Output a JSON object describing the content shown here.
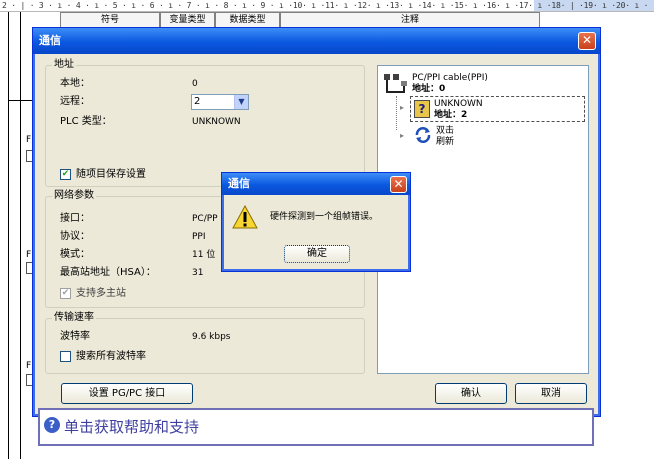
{
  "ruler": {
    "text": "2 · | · 3 · ı · 4 · ı · 5 · ı · 6 · ı · 7 · ı · 8 · ı · 9 · ı ·10· ı ·11· ı ·12· ı ·13· ı ·14· ı ·15· ı ·16· ı ·17· ı ·18· | ·19· ı ·20· ı ·"
  },
  "editor": {
    "columns": [
      "符号",
      "变量类型",
      "数据类型",
      "注释"
    ],
    "side_markers": [
      "F",
      "F",
      "F"
    ]
  },
  "dialog": {
    "title": "通信",
    "address_group": {
      "title": "地址",
      "local_label": "本地：",
      "local_value": "0",
      "remote_label": "远程：",
      "remote_value": "2",
      "plc_type_label": "PLC 类型：",
      "plc_type_value": "UNKNOWN",
      "save_with_project_label": "随项目保存设置",
      "save_with_project_checked": true
    },
    "network_group": {
      "title": "网络参数",
      "interface_label": "接口：",
      "interface_value": "PC/PP",
      "protocol_label": "协议：",
      "protocol_value": "PPI",
      "mode_label": "模式：",
      "mode_value": "11 位",
      "hsa_label": "最高站地址（HSA）：",
      "hsa_value": "31",
      "multi_master_label": "支持多主站",
      "multi_master_checked": true
    },
    "baud_group": {
      "title": "传输速率",
      "baud_label": "波特率",
      "baud_value": "9.6 kbps",
      "search_all_label": "搜索所有波特率",
      "search_all_checked": false
    },
    "tree": {
      "cable_label": "PC/PPI cable(PPI)",
      "cable_address": "地址：0",
      "device_name": "UNKNOWN",
      "device_address": "地址：2",
      "refresh_line1": "双击",
      "refresh_line2": "刷新"
    },
    "set_pgpc_label": "设置 PG/PC 接口",
    "ok_label": "确认",
    "cancel_label": "取消"
  },
  "message_box": {
    "title": "通信",
    "message": "硬件探测到一个组帧错误。",
    "ok_label": "确定"
  },
  "help": {
    "text": "单击获取帮助和支持"
  },
  "colors": {
    "titlebar": "#0a58e0",
    "dialog_bg": "#ece9d8",
    "close": "#c9401c",
    "help_text": "#4040a0"
  }
}
